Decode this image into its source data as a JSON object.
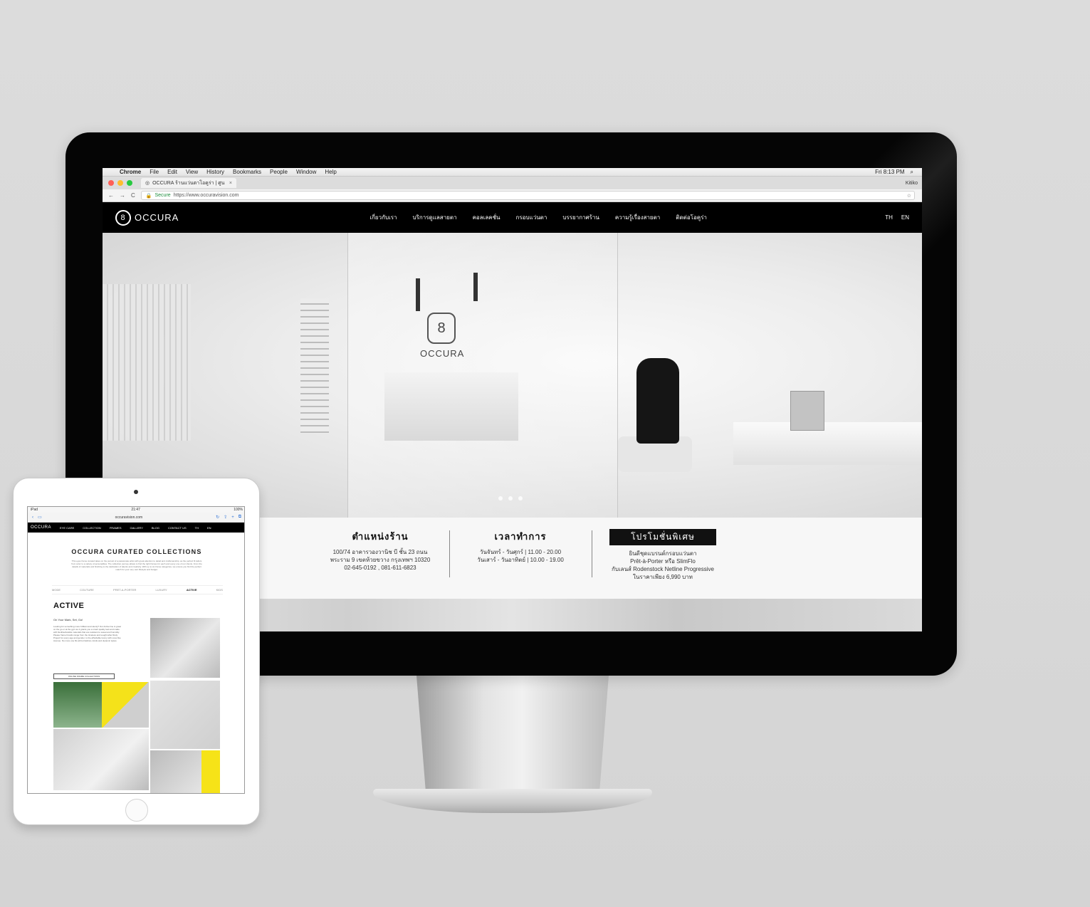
{
  "mac_menubar": {
    "apple": "",
    "app": "Chrome",
    "menus": [
      "File",
      "Edit",
      "View",
      "History",
      "Bookmarks",
      "People",
      "Window",
      "Help"
    ],
    "clock": "Fri 8:13 PM"
  },
  "browser": {
    "tab_title": "OCCURA ร้านแว่นตาโอคูร่า | ศูน",
    "tab_close": "×",
    "profile": "Kitiko",
    "secure_label": "Secure",
    "url": "https://www.occuravision.com",
    "back": "←",
    "forward": "→",
    "reload": "C",
    "star": "☆"
  },
  "site": {
    "logo_mark": "8",
    "logo_text": "OCCURA",
    "nav": [
      "เกี่ยวกับเรา",
      "บริการดูแลสายตา",
      "คอลเลคชั่น",
      "กรอบแว่นตา",
      "บรรยากาศร้าน",
      "ความรู้เรื่องสายตา",
      "ติดต่อโอคูร่า"
    ],
    "lang": [
      "TH",
      "EN"
    ],
    "hero_logo_mark": "8",
    "hero_logo_text": "OCCURA",
    "location": {
      "title": "ตำแหน่งร้าน",
      "line1": "100/74 อาคารวองวานิช บี ชั้น 23 ถนน",
      "line2": "พระราม 9 เขตห้วยขวาง กรุงเทพฯ 10320",
      "line3": "02-645-0192 , 081-611-6823"
    },
    "hours": {
      "title": "เวลาทำการ",
      "line1": "วันจันทร์ - วันศุกร์ | 11.00 - 20.00",
      "line2": "วันเสาร์ - วันอาทิตย์ | 10.00 - 19.00"
    },
    "promo": {
      "title": "โปรโมชั่นพิเศษ",
      "line1": "ยินดีชุดแบรนด์กรอบแว่นตา",
      "line2": "Prêt-à-Porter หรือ SlimFlo",
      "line3": "กับเลนส์ Rodenstock Netline Progressive",
      "line4": "ในราคาเพียง 6,990 บาท"
    }
  },
  "apple_logo": "",
  "ipad": {
    "status_left": "iPad",
    "status_time": "21:47",
    "status_right": "100%",
    "url": "occuravision.com",
    "brand": "OCCURA",
    "nav": [
      "EYE CARE",
      "COLLECTION",
      "FRAMES",
      "GALLERY",
      "BLOG",
      "CONTACT US",
      "TH",
      "EN"
    ],
    "title": "OCCURA CURATED COLLECTIONS",
    "intro": "This eyes frame curated takes on the pursuit of a passionate artist with great attention to detail and craftsmanship, as the perfect fit tailors from color to a variety of personalities. The collection journey allows to find the right frames for each and every one of our clients. From the details of materials and finishing to the dedication of talents and creativity. With up to six frame categories, we ensure you find the perfect match for your very own lifestyle and budget.",
    "filters": [
      "MODE",
      "COUTURE",
      "PRET-A-PORTER",
      "LUXURY",
      "ACTIVE",
      "KIDS"
    ],
    "active_filter": "ACTIVE",
    "section_title": "ACTIVE",
    "subtitle": "On Your Mark, Set, Go!",
    "body": "Looking for something more brilliant and sturdy? Our Active line is great on the go or at the gym as it grants you a smart quality look and made with flexible/durable materials that are resistant to sweat and humidity. Please frame brands range from the timeless and sought after Rudy Project for every age and gender, to the affordable luxury with ones like Avenue. No more one fits all but fashion-minds and dynamic styles.",
    "button": "ONLINE FRAME COLLECTIONS"
  },
  "colors": {
    "background": "#d9d9d9",
    "site_nav": "#000000",
    "accent_yellow": "#f4e21a"
  }
}
